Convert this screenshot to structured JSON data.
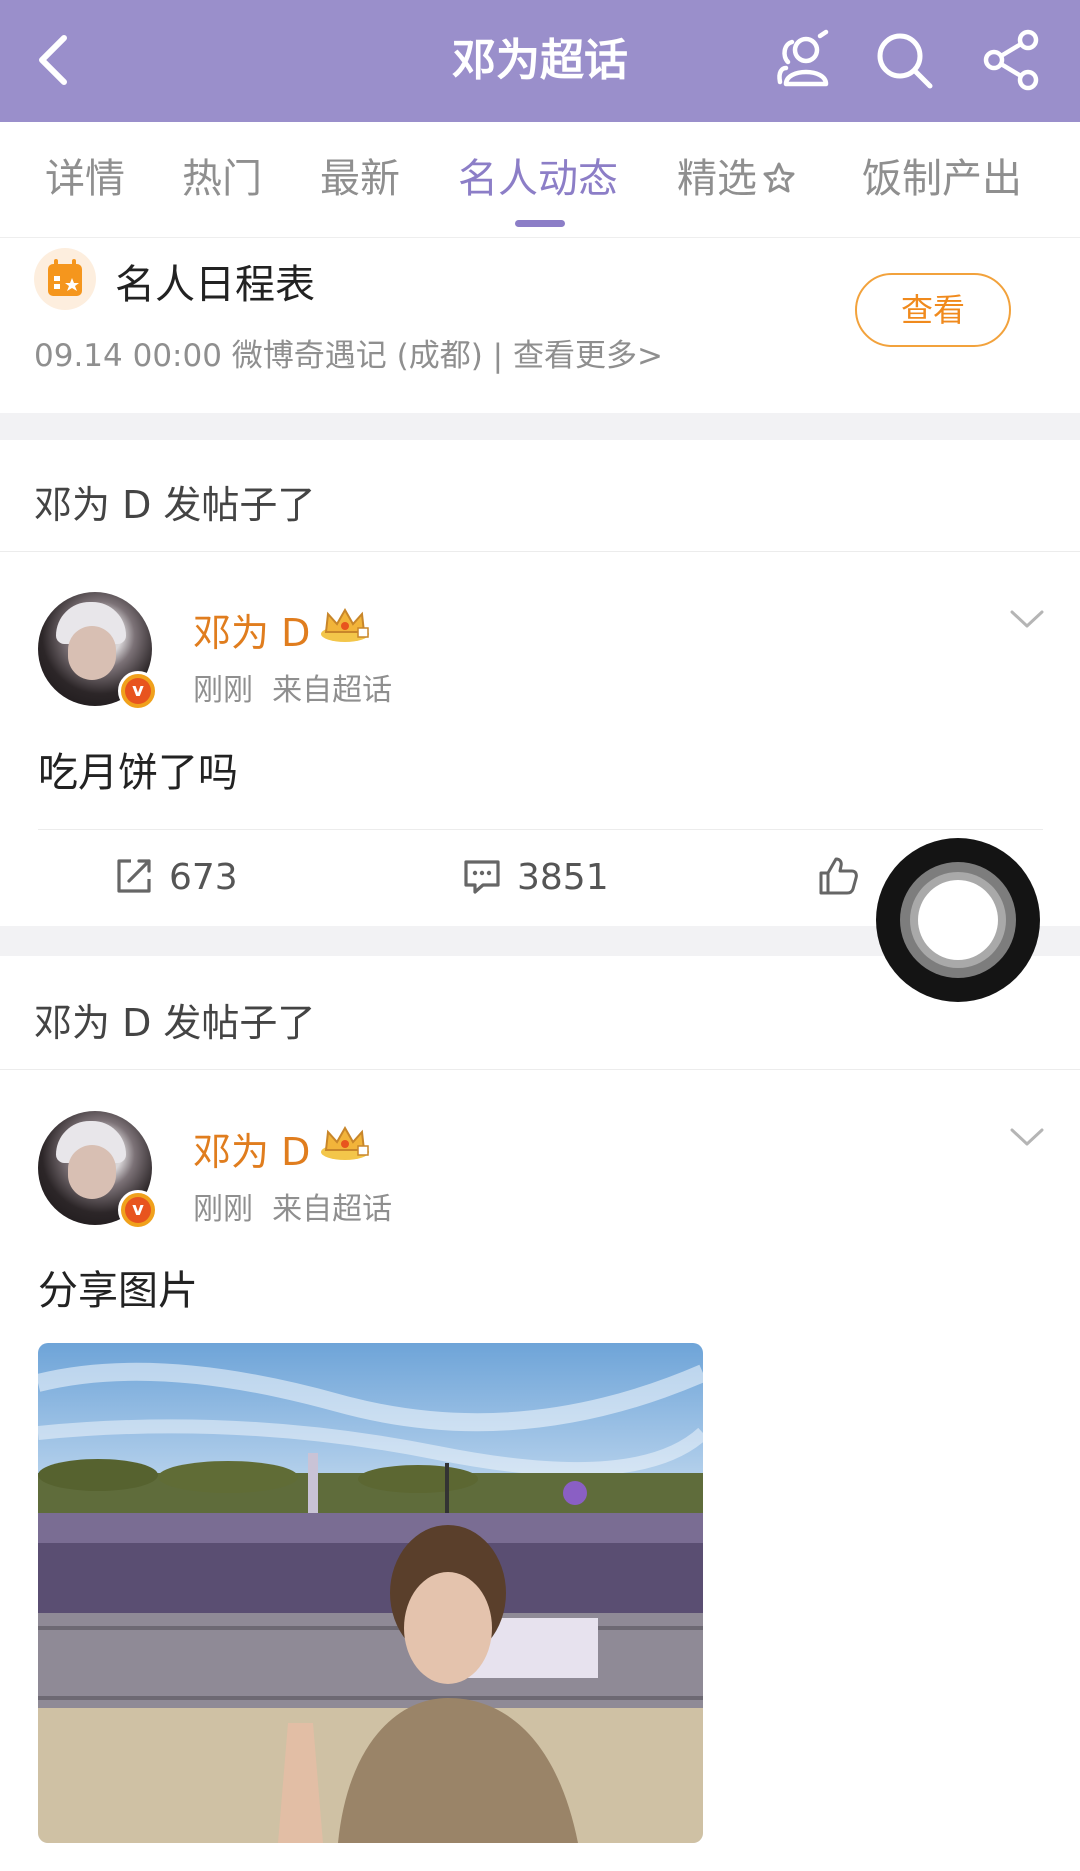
{
  "header": {
    "title": "邓为超话",
    "bg_color": "#9a8fcb"
  },
  "tabs": [
    {
      "label": "详情"
    },
    {
      "label": "热门"
    },
    {
      "label": "最新"
    },
    {
      "label": "名人动态",
      "active": true
    },
    {
      "label": "精选"
    },
    {
      "label": "饭制产出"
    }
  ],
  "schedule": {
    "title": "名人日程表",
    "subtitle": "09.14 00:00 微博奇遇记 (成都) |  查看更多>",
    "button": "查看"
  },
  "posts": [
    {
      "section_label": "邓为 D 发帖子了",
      "username": "邓为 D",
      "meta_time": "刚刚",
      "meta_source": "来自超话",
      "text": "吃月饼了吗",
      "reposts": "673",
      "comments": "3851"
    },
    {
      "section_label": "邓为 D 发帖子了",
      "username": "邓为 D",
      "meta_time": "刚刚",
      "meta_source": "来自超话",
      "text": "分享图片"
    }
  ],
  "colors": {
    "accent": "#8c7ec7",
    "username": "#e07d1e",
    "schedule_button": "#f08a1d"
  }
}
